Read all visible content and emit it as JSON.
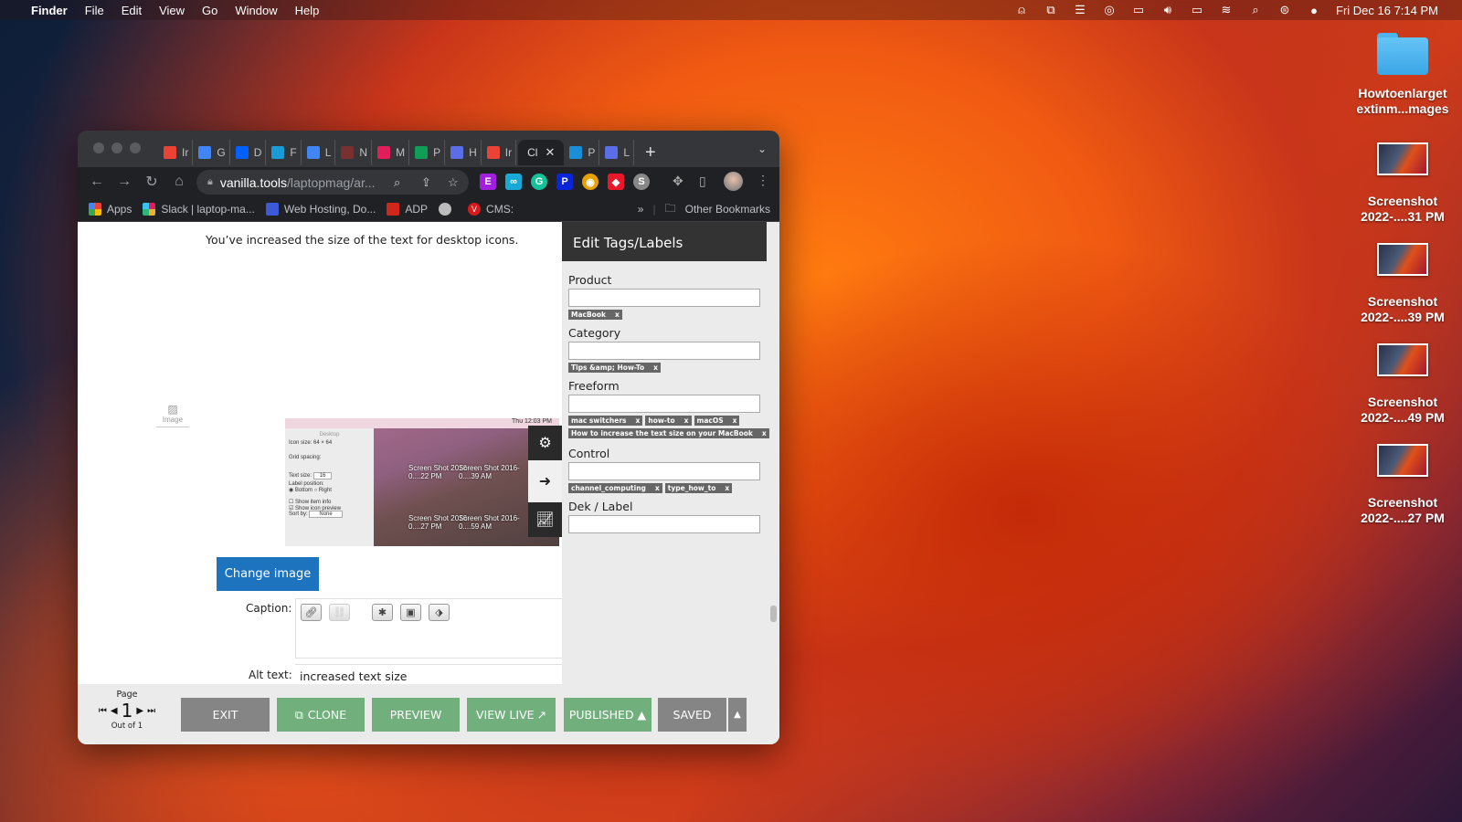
{
  "menubar": {
    "apple": "",
    "app": "Finder",
    "items": [
      "File",
      "Edit",
      "View",
      "Go",
      "Window",
      "Help"
    ],
    "status_icons": [
      "vpn-icon",
      "screen-mirroring-icon",
      "stack-icon",
      "cd-icon",
      "display-icon",
      "volume-icon",
      "battery-icon",
      "wifi-icon",
      "spotlight-icon",
      "control-center-icon",
      "siri-icon"
    ],
    "clock": "Fri Dec 16  7:14 PM"
  },
  "desktop": {
    "items": [
      {
        "type": "folder",
        "label1": "Howtoenlarget",
        "label2": "extinm...mages"
      },
      {
        "type": "screenshot",
        "label1": "Screenshot",
        "label2": "2022-....31 PM"
      },
      {
        "type": "screenshot",
        "label1": "Screenshot",
        "label2": "2022-....39 PM"
      },
      {
        "type": "screenshot",
        "label1": "Screenshot",
        "label2": "2022-....49 PM"
      },
      {
        "type": "screenshot",
        "label1": "Screenshot",
        "label2": "2022-....27 PM"
      }
    ]
  },
  "browser": {
    "tabs": [
      {
        "title": "Ir",
        "icon": "gmail-icon",
        "color": "#ea4335"
      },
      {
        "title": "G",
        "icon": "google-docs-icon",
        "color": "#4285f4"
      },
      {
        "title": "D",
        "icon": "dropbox-icon",
        "color": "#0061fe"
      },
      {
        "title": "F",
        "icon": "search-tool-icon",
        "color": "#1a9bd7"
      },
      {
        "title": "L",
        "icon": "google-docs-icon",
        "color": "#4285f4"
      },
      {
        "title": "N",
        "icon": "notion-icon",
        "color": "#7a3030"
      },
      {
        "title": "M",
        "icon": "slack-icon",
        "color": "#e01e5a"
      },
      {
        "title": "P",
        "icon": "google-sheets-icon",
        "color": "#0f9d58"
      },
      {
        "title": "H",
        "icon": "l-app-icon",
        "color": "#5a6ee8"
      },
      {
        "title": "Ir",
        "icon": "gmail-icon",
        "color": "#ea4335"
      },
      {
        "title": "Cl",
        "icon": "",
        "color": "",
        "active": true
      },
      {
        "title": "P",
        "icon": "x-app-icon",
        "color": "#1a8fd7"
      },
      {
        "title": "L",
        "icon": "l-app-icon",
        "color": "#5a6ee8"
      }
    ],
    "new_tab": "+",
    "tab_menu": "⌄",
    "url_host": "vanilla.tools",
    "url_path": "/laptopmag/ar...",
    "extensions": [
      {
        "name": "e-extension-icon",
        "glyph": "E",
        "color": "#a21fe0"
      },
      {
        "name": "link-extension-icon",
        "glyph": "∞",
        "color": "#18a9d6"
      },
      {
        "name": "grammarly-icon",
        "glyph": "G",
        "color": "#15c39a"
      },
      {
        "name": "p-extension-icon",
        "glyph": "P",
        "color": "#0a24d8"
      },
      {
        "name": "chrome-extension-icon",
        "glyph": "◉",
        "color": "#e8a000"
      },
      {
        "name": "tag-extension-icon",
        "glyph": "◆",
        "color": "#e8182a"
      },
      {
        "name": "s-extension-icon",
        "glyph": "S",
        "color": "#888"
      }
    ],
    "bookmarks": [
      {
        "label": "Apps",
        "icon": "apps-grid-icon"
      },
      {
        "label": "Slack | laptop-ma...",
        "icon": "slack-icon"
      },
      {
        "label": "Web Hosting, Do...",
        "icon": "grid-icon"
      },
      {
        "label": "ADP",
        "icon": "adp-icon"
      },
      {
        "label": "",
        "icon": "globe-icon"
      },
      {
        "label": "CMS:",
        "icon": "v-icon"
      }
    ],
    "bookmarks_overflow": "»",
    "other_bookmarks": "Other Bookmarks"
  },
  "editor": {
    "lead_text": "You’ve increased the size of the text for desktop icons.",
    "image_placeholder": "Image",
    "screenshot": {
      "menubar_text": "Thu 12:03 PM",
      "pref_title": "Desktop",
      "icon_size": "Icon size:  64 × 64",
      "grid_spacing": "Grid spacing:",
      "text_size": "Text size:",
      "text_size_val": "16",
      "label_position": "Label position:",
      "bottom": "Bottom",
      "right": "Right",
      "show_item_info": "Show item info",
      "show_icon_preview": "Show icon preview",
      "sort_by": "Sort by:",
      "sort_val": "None",
      "file1": "Screen Shot 2016-0....22 PM",
      "file2": "Screen Shot 2016-0....39 AM",
      "file3": "Screen Shot 2016-0....27 PM",
      "file4": "Screen Shot 2016-0....59 AM"
    },
    "change_image": "Change image",
    "caption_label": "Caption:",
    "alt_label": "Alt text:",
    "alt_value": "increased text size"
  },
  "tags_panel": {
    "title": "Edit Tags/Labels",
    "fields": [
      {
        "label": "Product",
        "value": "",
        "tags": [
          "MacBook"
        ]
      },
      {
        "label": "Category",
        "value": "",
        "tags": [
          "Tips &amp; How-To"
        ]
      },
      {
        "label": "Freeform",
        "value": "",
        "tags": [
          "mac switchers",
          "how-to",
          "macOS",
          "How to increase the text size on your MacBook"
        ]
      },
      {
        "label": "Control",
        "value": "",
        "tags": [
          "channel_computing",
          "type_how_to"
        ]
      },
      {
        "label": "Dek / Label",
        "value": "",
        "tags": []
      }
    ],
    "remove": "x"
  },
  "footer": {
    "page_label": "Page",
    "page_num": "1",
    "out_of": "Out of 1",
    "exit": "EXIT",
    "clone": "CLONE",
    "preview": "PREVIEW",
    "view_live": "VIEW LIVE",
    "published": "PUBLISHED ▲",
    "saved": "SAVED",
    "more": "▲"
  },
  "colors": {
    "primary_blue": "#1e73be",
    "action_green": "#71b07c",
    "neutral_grey": "#858585",
    "tag_grey": "#666666"
  }
}
